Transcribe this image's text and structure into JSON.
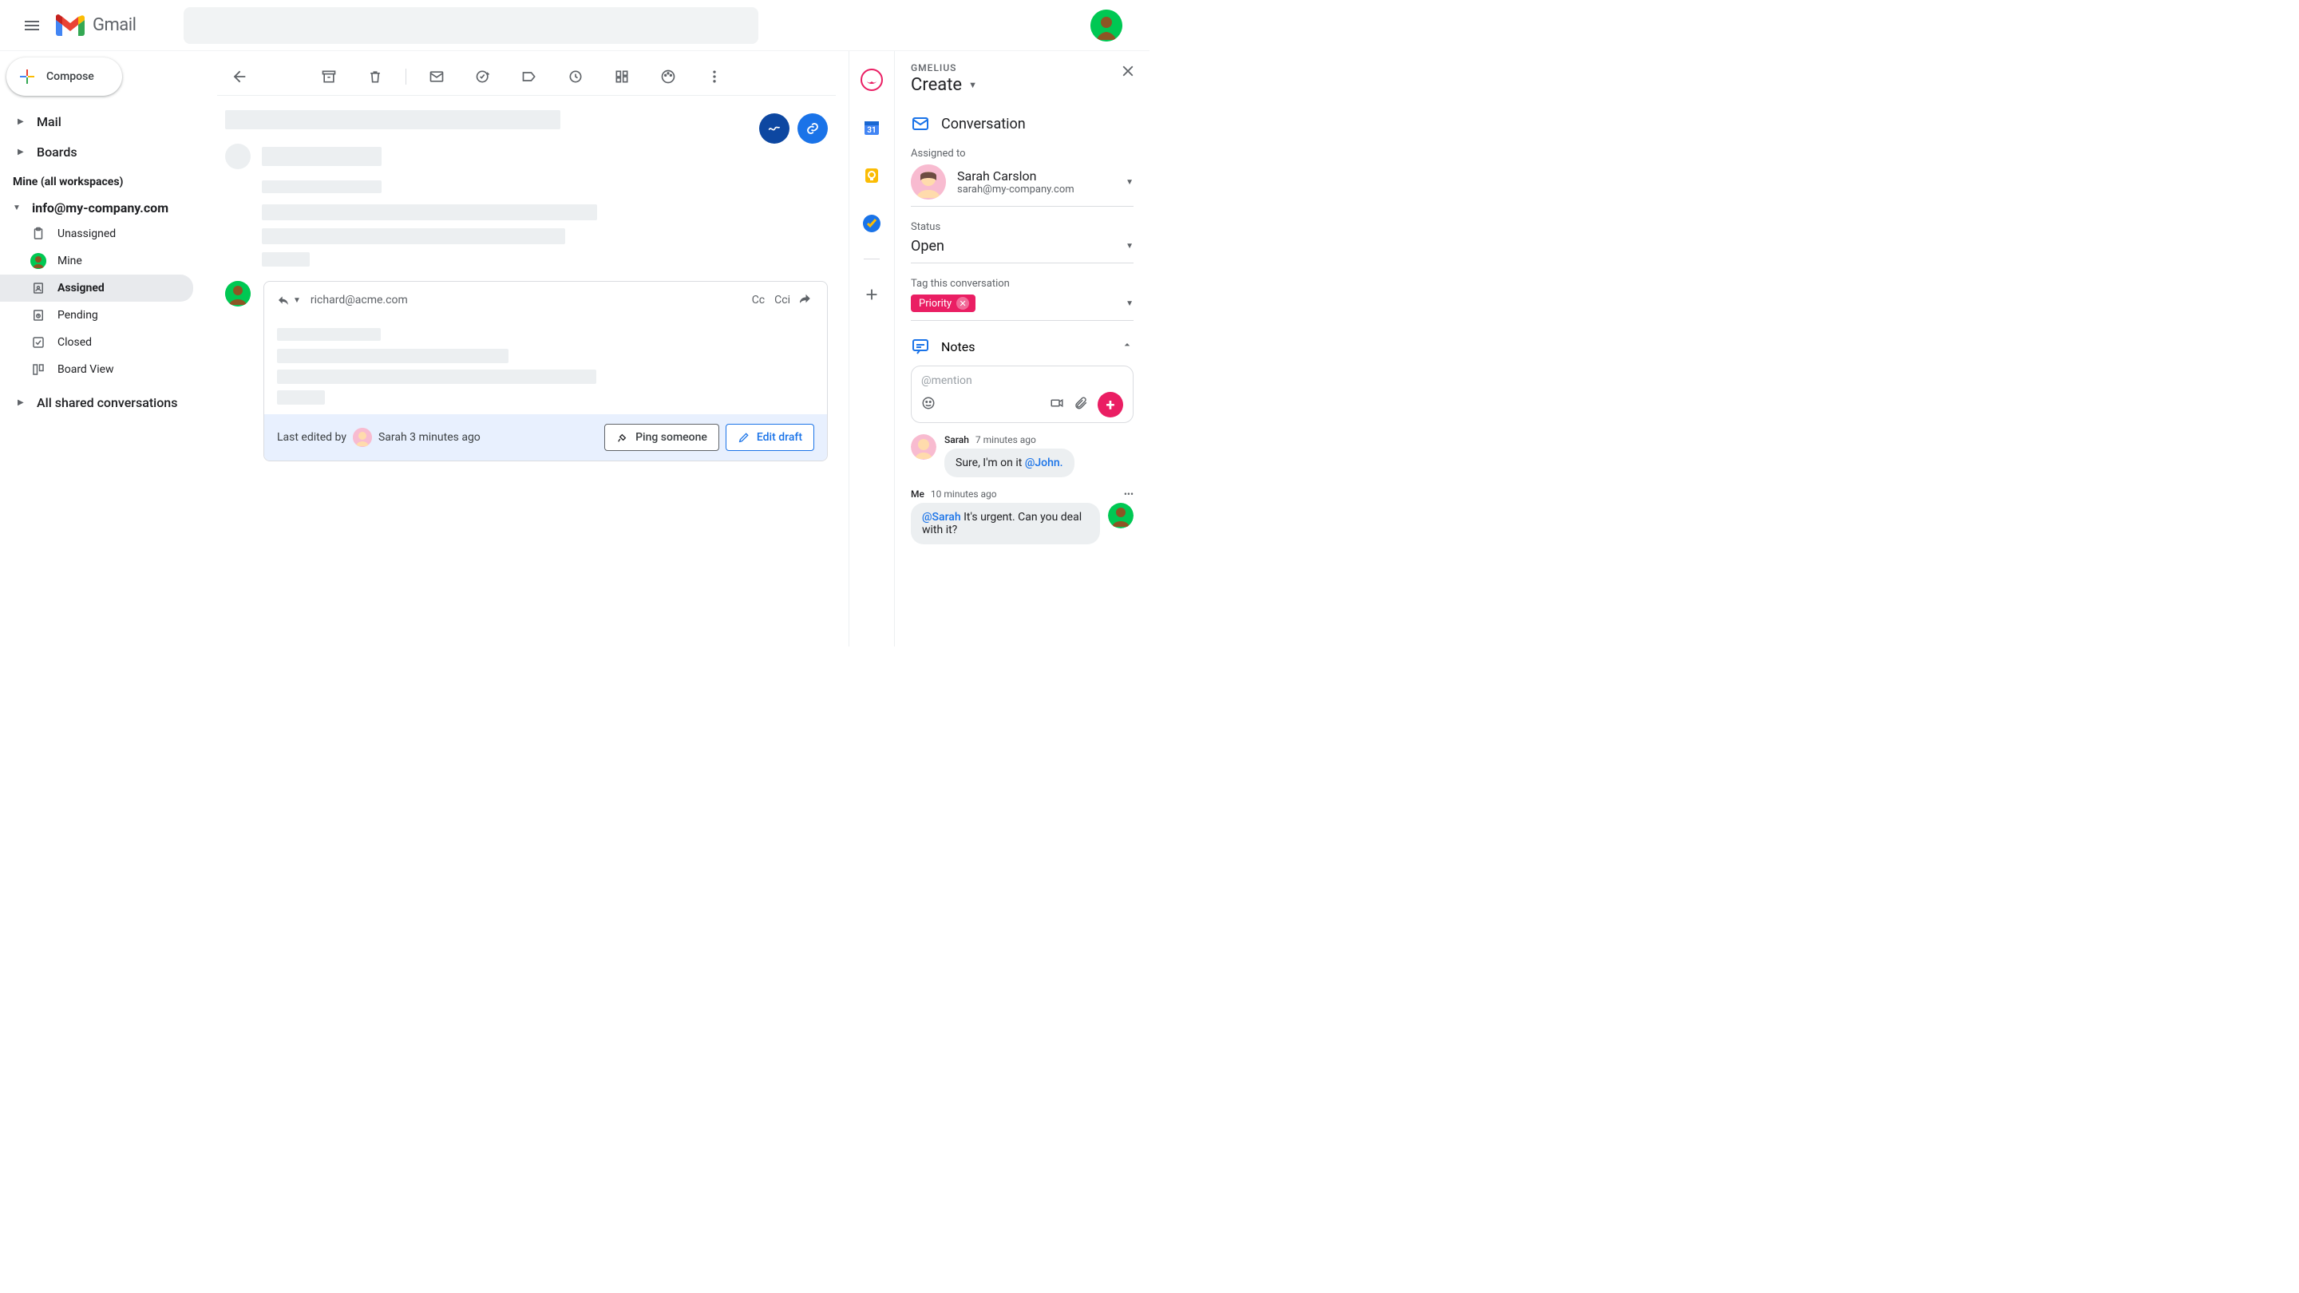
{
  "header": {
    "product": "Gmail"
  },
  "sidebar": {
    "compose": "Compose",
    "mail": "Mail",
    "boards": "Boards",
    "mine_header": "Mine (all workspaces)",
    "workspace_email": "info@my-company.com",
    "items": [
      {
        "label": "Unassigned"
      },
      {
        "label": "Mine"
      },
      {
        "label": "Assigned"
      },
      {
        "label": "Pending"
      },
      {
        "label": "Closed"
      },
      {
        "label": "Board View"
      }
    ],
    "shared": "All shared conversations"
  },
  "compose": {
    "to": "richard@acme.com",
    "cc": "Cc",
    "cci": "Cci",
    "footer_prefix": "Last edited by",
    "footer_name": "Sarah 3 minutes ago",
    "ping": "Ping someone",
    "edit": "Edit draft"
  },
  "panel": {
    "brand": "GMELIUS",
    "create": "Create",
    "conversation": "Conversation",
    "assigned_to_label": "Assigned to",
    "assignee": {
      "name": "Sarah Carslon",
      "email": "sarah@my-company.com"
    },
    "status_label": "Status",
    "status_value": "Open",
    "tag_label": "Tag this conversation",
    "tag_value": "Priority",
    "notes_header": "Notes",
    "mention_placeholder": "@mention",
    "notes": [
      {
        "author": "Sarah",
        "time": "7 minutes ago",
        "text_prefix": "Sure, I'm on it  ",
        "mention": "@John."
      },
      {
        "author": "Me",
        "time": "10 minutes ago",
        "mention": "@Sarah",
        "text_suffix": " It's urgent. Can you deal with it?"
      }
    ]
  }
}
